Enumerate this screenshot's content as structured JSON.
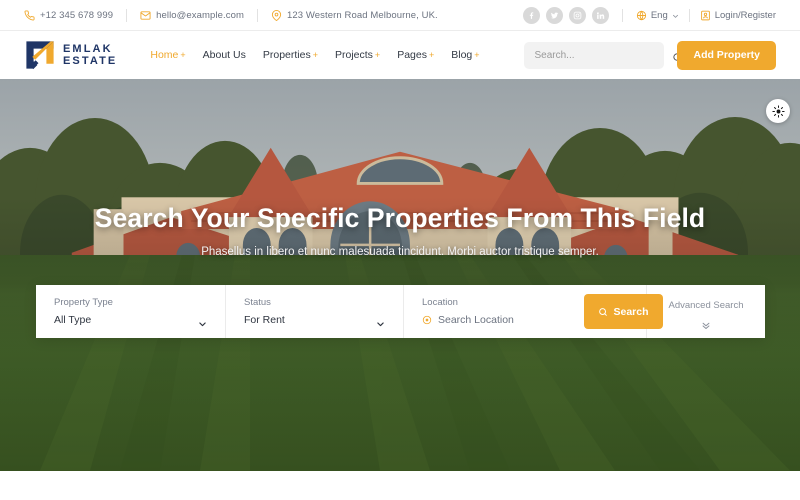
{
  "topbar": {
    "contacts": [
      {
        "icon": "phone-icon",
        "text": "+12 345 678 999"
      },
      {
        "icon": "mail-icon",
        "text": "hello@example.com"
      },
      {
        "icon": "map-pin-icon",
        "text": "123 Western Road Melbourne, UK."
      }
    ],
    "socials": [
      "facebook-icon",
      "twitter-icon",
      "instagram-icon",
      "linkedin-icon"
    ],
    "language": {
      "label": "Eng",
      "icon": "globe-icon"
    },
    "account": {
      "label": "Login/Register",
      "icon": "user-badge-icon"
    }
  },
  "header": {
    "logo": {
      "line1": "EMLAK",
      "line2": "ESTATE"
    },
    "nav": [
      {
        "label": "Home",
        "has_plus": true,
        "active": true
      },
      {
        "label": "About Us",
        "has_plus": false,
        "active": false
      },
      {
        "label": "Properties",
        "has_plus": true,
        "active": false
      },
      {
        "label": "Projects",
        "has_plus": true,
        "active": false
      },
      {
        "label": "Pages",
        "has_plus": true,
        "active": false
      },
      {
        "label": "Blog",
        "has_plus": true,
        "active": false
      }
    ],
    "search": {
      "placeholder": "Search...",
      "value": ""
    },
    "add_property_label": "Add Property"
  },
  "hero": {
    "title": "Search Your Specific Properties From This Field",
    "subtitle": "Phasellus in libero et nunc malesuada tincidunt. Morbi auctor tristique semper.",
    "theme_toggle_icon": "sun-brightness-icon"
  },
  "search_panel": {
    "property_type": {
      "label": "Property Type",
      "value": "All Type"
    },
    "status": {
      "label": "Status",
      "value": "For Rent"
    },
    "location": {
      "label": "Location",
      "value": "Search Location",
      "icon": "locate-icon"
    },
    "search_button": {
      "label": "Search",
      "icon": "search-icon"
    },
    "advanced": {
      "label": "Advanced Search",
      "icon": "double-chevron-down-icon"
    }
  },
  "colors": {
    "accent_orange": "#f0a92e",
    "logo_navy": "#1f3566",
    "text_dark": "#333a45",
    "text_muted": "#6c7380",
    "search_field_bg": "#f2f2f2",
    "social_circle": "#d9d9d9"
  }
}
